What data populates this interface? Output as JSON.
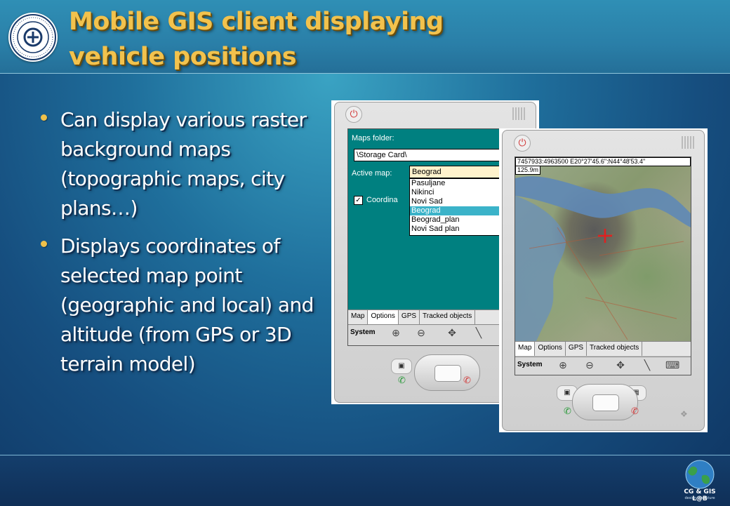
{
  "slide": {
    "title_line1": "Mobile GIS client displaying",
    "title_line2": "vehicle positions",
    "bullets": [
      "Can display various raster background maps (topographic maps, city plans…)",
      "Displays coordinates of selected map point (geographic and local) and altitude (from GPS or 3D terrain model)"
    ]
  },
  "colors": {
    "title": "#f2c24d",
    "bullet_dot": "#f0c14a",
    "screen_teal": "#008080",
    "list_selected": "#3bb3c9"
  },
  "device_settings": {
    "maps_folder_label": "Maps folder:",
    "maps_folder_value": "\\Storage Card\\",
    "active_map_label": "Active map:",
    "active_map_value": "Beograd",
    "map_options": [
      "Pasuljane",
      "Nikinci",
      "Novi Sad",
      "Beograd",
      "Beograd_plan",
      "Novi Sad plan"
    ],
    "selected_option": "Beograd",
    "checkbox_label": "Coordina",
    "tabs": [
      "Map",
      "Options",
      "GPS",
      "Tracked objects"
    ],
    "active_tab": "Options",
    "toolbar_label": "System"
  },
  "device_map": {
    "coords": "7457933:4963500    E20°27'45.6\":N44°48'53.4\"",
    "altitude": "125.9m",
    "tabs": [
      "Map",
      "Options",
      "GPS",
      "Tracked objects"
    ],
    "active_tab": "Map",
    "toolbar_label": "System",
    "icons": [
      "zoom-in-icon",
      "zoom-out-icon",
      "pan-icon",
      "measure-icon",
      "keyboard-icon"
    ]
  },
  "footer": {
    "lab_logo_text": "CG & GIS L@B",
    "lab_logo_tagline": "design the future"
  }
}
